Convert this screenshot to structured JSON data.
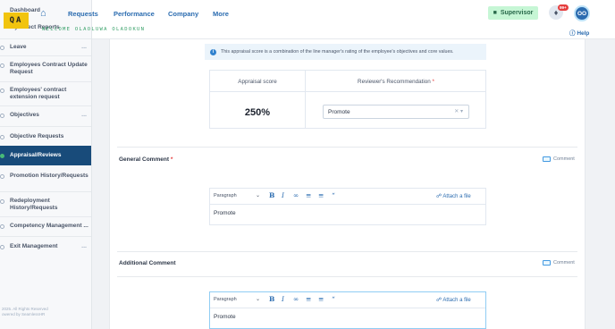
{
  "sidebar": {
    "logo": "QA",
    "items": [
      {
        "label": "Dashboard"
      },
      {
        "label": "My Direct Reports"
      },
      {
        "label": "Leave"
      },
      {
        "label": "Employees Contract Update Request"
      },
      {
        "label": "Employees' contract extension request"
      },
      {
        "label": "Objectives"
      },
      {
        "label": "Objective Requests"
      },
      {
        "label": "Appraisal/Reviews"
      },
      {
        "label": "Promotion History/Requests"
      },
      {
        "label": "Redeployment History/Requests"
      },
      {
        "label": "Competency Management ..."
      },
      {
        "label": "Exit Management"
      }
    ],
    "copyright": "2025. All Rights Reserved",
    "powered_by": "owered by SeamlessHR"
  },
  "header": {
    "nav": [
      "Requests",
      "Performance",
      "Company",
      "More"
    ],
    "welcome": "WELCOME OLAOLUWA OLADOKUN",
    "role_button": "Supervisor",
    "notification_badge": "99+",
    "avatar_initials": "OO",
    "help": "Help"
  },
  "appraisal": {
    "info_text": "This appraisal score is a combination of the line manager's rating of the employee's objectives and core values.",
    "score_header": "Appraisal score",
    "recommendation_header": "Reviewer's Recommendation",
    "required_mark": "*",
    "score_value": "250%",
    "recommendation_value": "Promote"
  },
  "general_comment": {
    "label": "General Comment",
    "required_mark": "*",
    "comment_link": "Comment",
    "editor": {
      "paragraph": "Paragraph",
      "attach": "Attach a file",
      "text": "Promote"
    }
  },
  "additional_comment": {
    "label": "Additional Comment",
    "comment_link": "Comment",
    "editor": {
      "paragraph": "Paragraph",
      "attach": "Attach a file",
      "text": "Promote"
    }
  }
}
